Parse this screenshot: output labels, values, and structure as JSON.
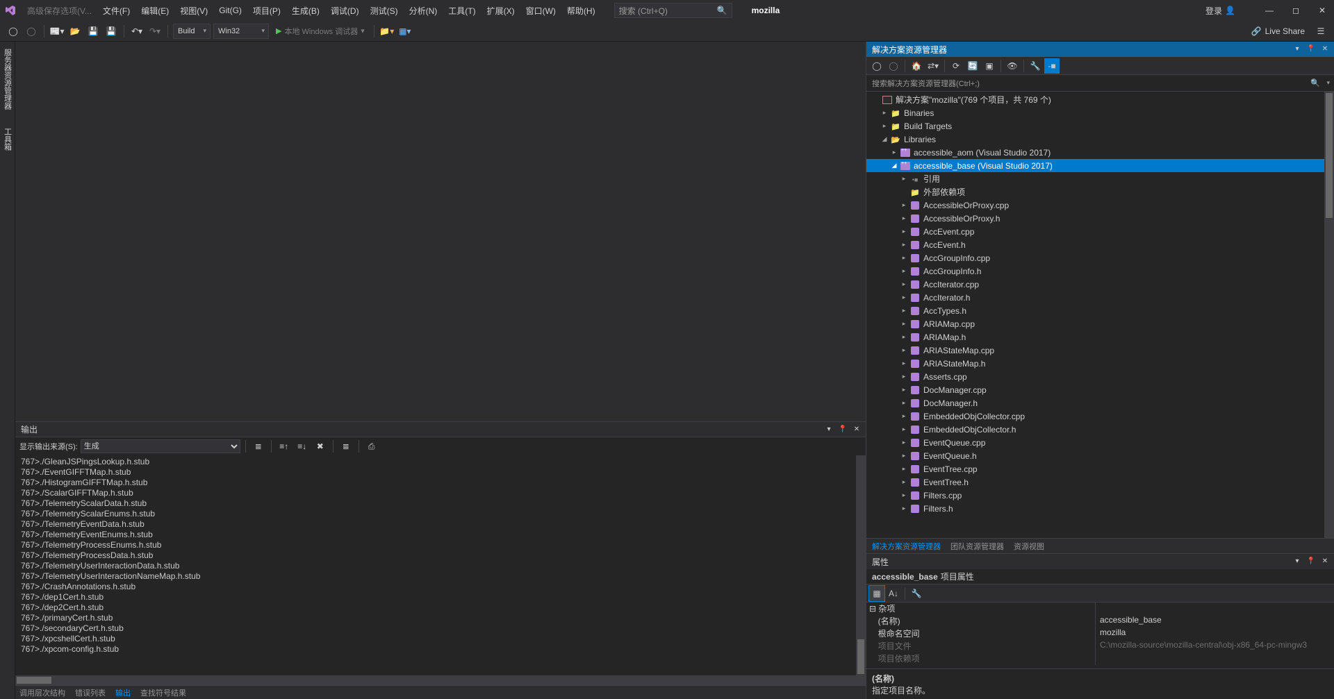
{
  "title_prefix": "高级保存选项(V...",
  "menu": [
    "文件(F)",
    "编辑(E)",
    "视图(V)",
    "Git(G)",
    "项目(P)",
    "生成(B)",
    "调试(D)",
    "测试(S)",
    "分析(N)",
    "工具(T)",
    "扩展(X)",
    "窗口(W)",
    "帮助(H)"
  ],
  "search_placeholder": "搜索 (Ctrl+Q)",
  "solution_badge": "mozilla",
  "login": "登录",
  "toolbar": {
    "config": "Build",
    "platform": "Win32",
    "debug_target": "本地 Windows 调试器"
  },
  "liveshare": "Live Share",
  "left_rail": [
    "服务器资源管理器",
    "工具箱"
  ],
  "output": {
    "title": "输出",
    "from_label": "显示输出来源(S):",
    "from_value": "生成",
    "lines": [
      "767>./GleanJSPingsLookup.h.stub",
      "767>./EventGIFFTMap.h.stub",
      "767>./HistogramGIFFTMap.h.stub",
      "767>./ScalarGIFFTMap.h.stub",
      "767>./TelemetryScalarData.h.stub",
      "767>./TelemetryScalarEnums.h.stub",
      "767>./TelemetryEventData.h.stub",
      "767>./TelemetryEventEnums.h.stub",
      "767>./TelemetryProcessEnums.h.stub",
      "767>./TelemetryProcessData.h.stub",
      "767>./TelemetryUserInteractionData.h.stub",
      "767>./TelemetryUserInteractionNameMap.h.stub",
      "767>./CrashAnnotations.h.stub",
      "767>./dep1Cert.h.stub",
      "767>./dep2Cert.h.stub",
      "767>./primaryCert.h.stub",
      "767>./secondaryCert.h.stub",
      "767>./xpcshellCert.h.stub",
      "767>./xpcom-config.h.stub"
    ]
  },
  "bottom_tabs": [
    "调用层次结构",
    "错误列表",
    "输出",
    "查找符号结果"
  ],
  "bottom_active": 2,
  "sln": {
    "title": "解决方案资源管理器",
    "search_placeholder": "搜索解决方案资源管理器(Ctrl+;)",
    "root": "解决方案\"mozilla\"(769 个项目，共 769 个)",
    "folders": [
      "Binaries",
      "Build Targets",
      "Libraries"
    ],
    "lib_projects": [
      "accessible_aom (Visual Studio 2017)",
      "accessible_base (Visual Studio 2017)"
    ],
    "sel_children_top": [
      "引用",
      "外部依赖项"
    ],
    "files": [
      "AccessibleOrProxy.cpp",
      "AccessibleOrProxy.h",
      "AccEvent.cpp",
      "AccEvent.h",
      "AccGroupInfo.cpp",
      "AccGroupInfo.h",
      "AccIterator.cpp",
      "AccIterator.h",
      "AccTypes.h",
      "ARIAMap.cpp",
      "ARIAMap.h",
      "ARIAStateMap.cpp",
      "ARIAStateMap.h",
      "Asserts.cpp",
      "DocManager.cpp",
      "DocManager.h",
      "EmbeddedObjCollector.cpp",
      "EmbeddedObjCollector.h",
      "EventQueue.cpp",
      "EventQueue.h",
      "EventTree.cpp",
      "EventTree.h",
      "Filters.cpp",
      "Filters.h"
    ],
    "bottom_tabs": [
      "解决方案资源管理器",
      "团队资源管理器",
      "资源视图"
    ]
  },
  "props": {
    "title": "属性",
    "object_name": "accessible_base",
    "object_type": "项目属性",
    "category": "杂项",
    "rows": [
      {
        "k": "(名称)",
        "v": "accessible_base"
      },
      {
        "k": "根命名空间",
        "v": "mozilla"
      },
      {
        "k": "项目文件",
        "v": "C:\\mozilla-source\\mozilla-central\\obj-x86_64-pc-mingw3",
        "dim": true
      },
      {
        "k": "项目依赖项",
        "v": "",
        "dim": true
      }
    ],
    "desc_name": "(名称)",
    "desc_text": "指定项目名称。"
  }
}
